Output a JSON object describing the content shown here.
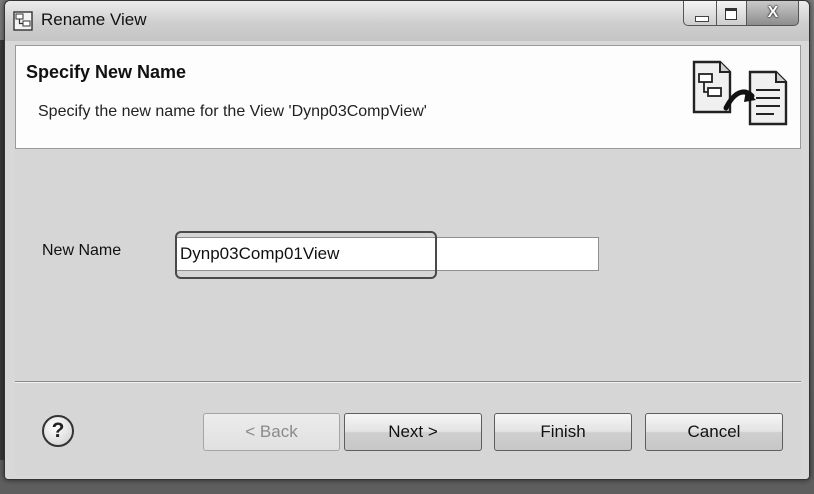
{
  "window": {
    "title": "Rename View",
    "controls": {
      "minimize_icon": "minimize-icon",
      "maximize_icon": "maximize-icon",
      "close_glyph": "X"
    }
  },
  "banner": {
    "title": "Specify New Name",
    "description": "Specify the new name for the View 'Dynp03CompView'",
    "icon": "rename-document-icon"
  },
  "form": {
    "new_name_label": "New Name",
    "new_name_value": "Dynp03Comp01View"
  },
  "footer": {
    "help_glyph": "?",
    "buttons": {
      "back": "< Back",
      "next": "Next >",
      "finish": "Finish",
      "cancel": "Cancel"
    },
    "back_enabled": false
  },
  "colors": {
    "dialog_bg": "#d6d6d6",
    "banner_bg": "#fdfdfd",
    "highlight_border": "#4a4a4a"
  }
}
